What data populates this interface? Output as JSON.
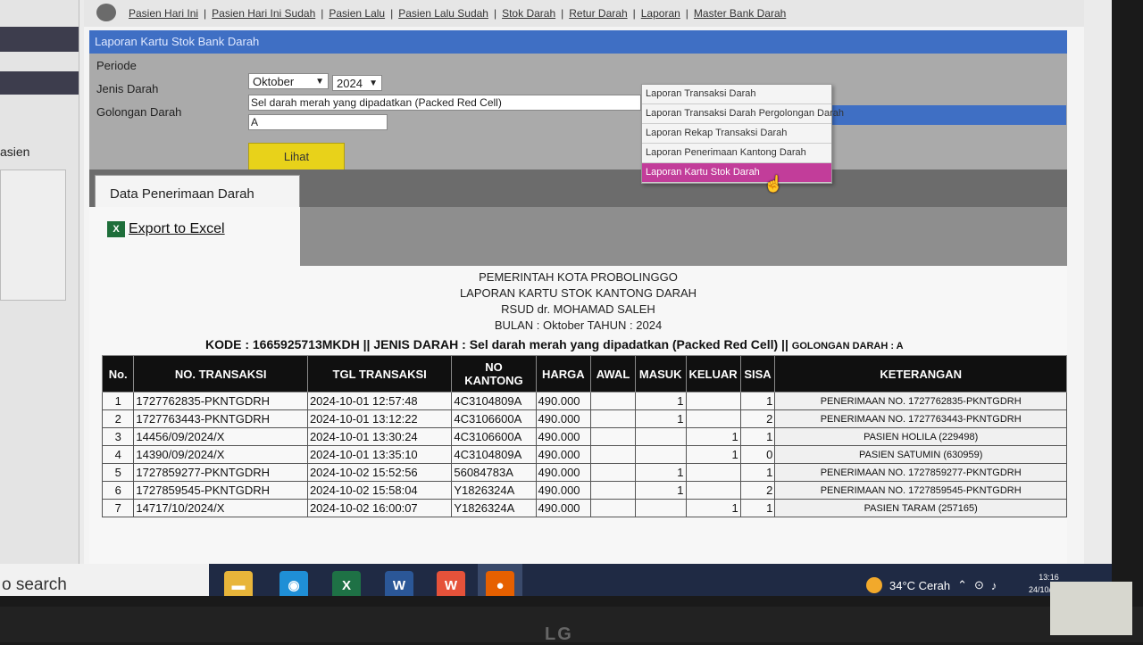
{
  "left_panel": {
    "label": "asien"
  },
  "topnav": {
    "links": [
      "Pasien Hari Ini",
      "Pasien Hari Ini Sudah",
      "Pasien Lalu",
      "Pasien Lalu Sudah",
      "Stok Darah",
      "Retur Darah",
      "Laporan",
      "Master Bank Darah"
    ],
    "separator": "|"
  },
  "panel_title": "Laporan Kartu Stok Bank Darah",
  "filters": {
    "periode_label": "Periode",
    "month": "Oktober",
    "year": "2024",
    "jenis_label": "Jenis Darah",
    "jenis_value": "Sel darah merah yang dipadatkan (Packed Red Cell)",
    "golongan_label": "Golongan Darah",
    "golongan_value": "A",
    "lihat_button": "Lihat"
  },
  "dropdown": {
    "items": [
      "Laporan Transaksi Darah",
      "Laporan Transaksi Darah Pergolongan Darah",
      "Laporan Rekap Transaksi Darah",
      "Laporan Penerimaan Kantong Darah",
      "Laporan Kartu Stok Darah"
    ],
    "active_index": 4,
    "active_color": "#c23d9a"
  },
  "tab_label": "Data Penerimaan Darah",
  "export_label": "Export to Excel",
  "report": {
    "line1": "PEMERINTAH KOTA PROBOLINGGO",
    "line2": "LAPORAN KARTU STOK KANTONG DARAH",
    "line3": "RSUD dr. MOHAMAD SALEH",
    "line4": "BULAN   : Oktober TAHUN : 2024",
    "kode": "KODE   : 1665925713MKDH  ||  JENIS DARAH : Sel darah merah yang dipadatkan (Packed Red Cell)  ||",
    "golongan": "GOLONGAN DARAH   : A"
  },
  "table": {
    "headers": [
      "No.",
      "NO. TRANSAKSI",
      "TGL TRANSAKSI",
      "NO KANTONG",
      "HARGA",
      "AWAL",
      "MASUK",
      "KELUAR",
      "SISA",
      "KETERANGAN"
    ],
    "rows": [
      [
        "1",
        "1727762835-PKNTGDRH",
        "2024-10-01 12:57:48",
        "4C3104809A",
        "490.000",
        "",
        "1",
        "",
        "1",
        "PENERIMAAN NO. 1727762835-PKNTGDRH"
      ],
      [
        "2",
        "1727763443-PKNTGDRH",
        "2024-10-01 13:12:22",
        "4C3106600A",
        "490.000",
        "",
        "1",
        "",
        "2",
        "PENERIMAAN NO. 1727763443-PKNTGDRH"
      ],
      [
        "3",
        "14456/09/2024/X",
        "2024-10-01 13:30:24",
        "4C3106600A",
        "490.000",
        "",
        "",
        "1",
        "1",
        "PASIEN HOLILA (229498)"
      ],
      [
        "4",
        "14390/09/2024/X",
        "2024-10-01 13:35:10",
        "4C3104809A",
        "490.000",
        "",
        "",
        "1",
        "0",
        "PASIEN SATUMIN (630959)"
      ],
      [
        "5",
        "1727859277-PKNTGDRH",
        "2024-10-02 15:52:56",
        "56084783A",
        "490.000",
        "",
        "1",
        "",
        "1",
        "PENERIMAAN NO. 1727859277-PKNTGDRH"
      ],
      [
        "6",
        "1727859545-PKNTGDRH",
        "2024-10-02 15:58:04",
        "Y1826324A",
        "490.000",
        "",
        "1",
        "",
        "2",
        "PENERIMAAN NO. 1727859545-PKNTGDRH"
      ],
      [
        "7",
        "14717/10/2024/X",
        "2024-10-02 16:00:07",
        "Y1826324A",
        "490.000",
        "",
        "",
        "1",
        "1",
        "PASIEN TARAM (257165)"
      ]
    ]
  },
  "taskbar": {
    "search": "o search",
    "apps": [
      {
        "name": "file-explorer-icon",
        "glyph": "▬",
        "color": "#e8b53a"
      },
      {
        "name": "edge-icon",
        "glyph": "◉",
        "color": "#1f8fd6"
      },
      {
        "name": "excel-icon",
        "glyph": "X",
        "color": "#1e7145"
      },
      {
        "name": "word-icon",
        "glyph": "W",
        "color": "#2b5797"
      },
      {
        "name": "wps-icon",
        "glyph": "W",
        "color": "#e5523a"
      },
      {
        "name": "firefox-icon",
        "glyph": "●",
        "color": "#e66000"
      }
    ],
    "weather": "34°C  Cerah",
    "time": "13:16",
    "date": "24/10/2024"
  },
  "brand": "LG"
}
